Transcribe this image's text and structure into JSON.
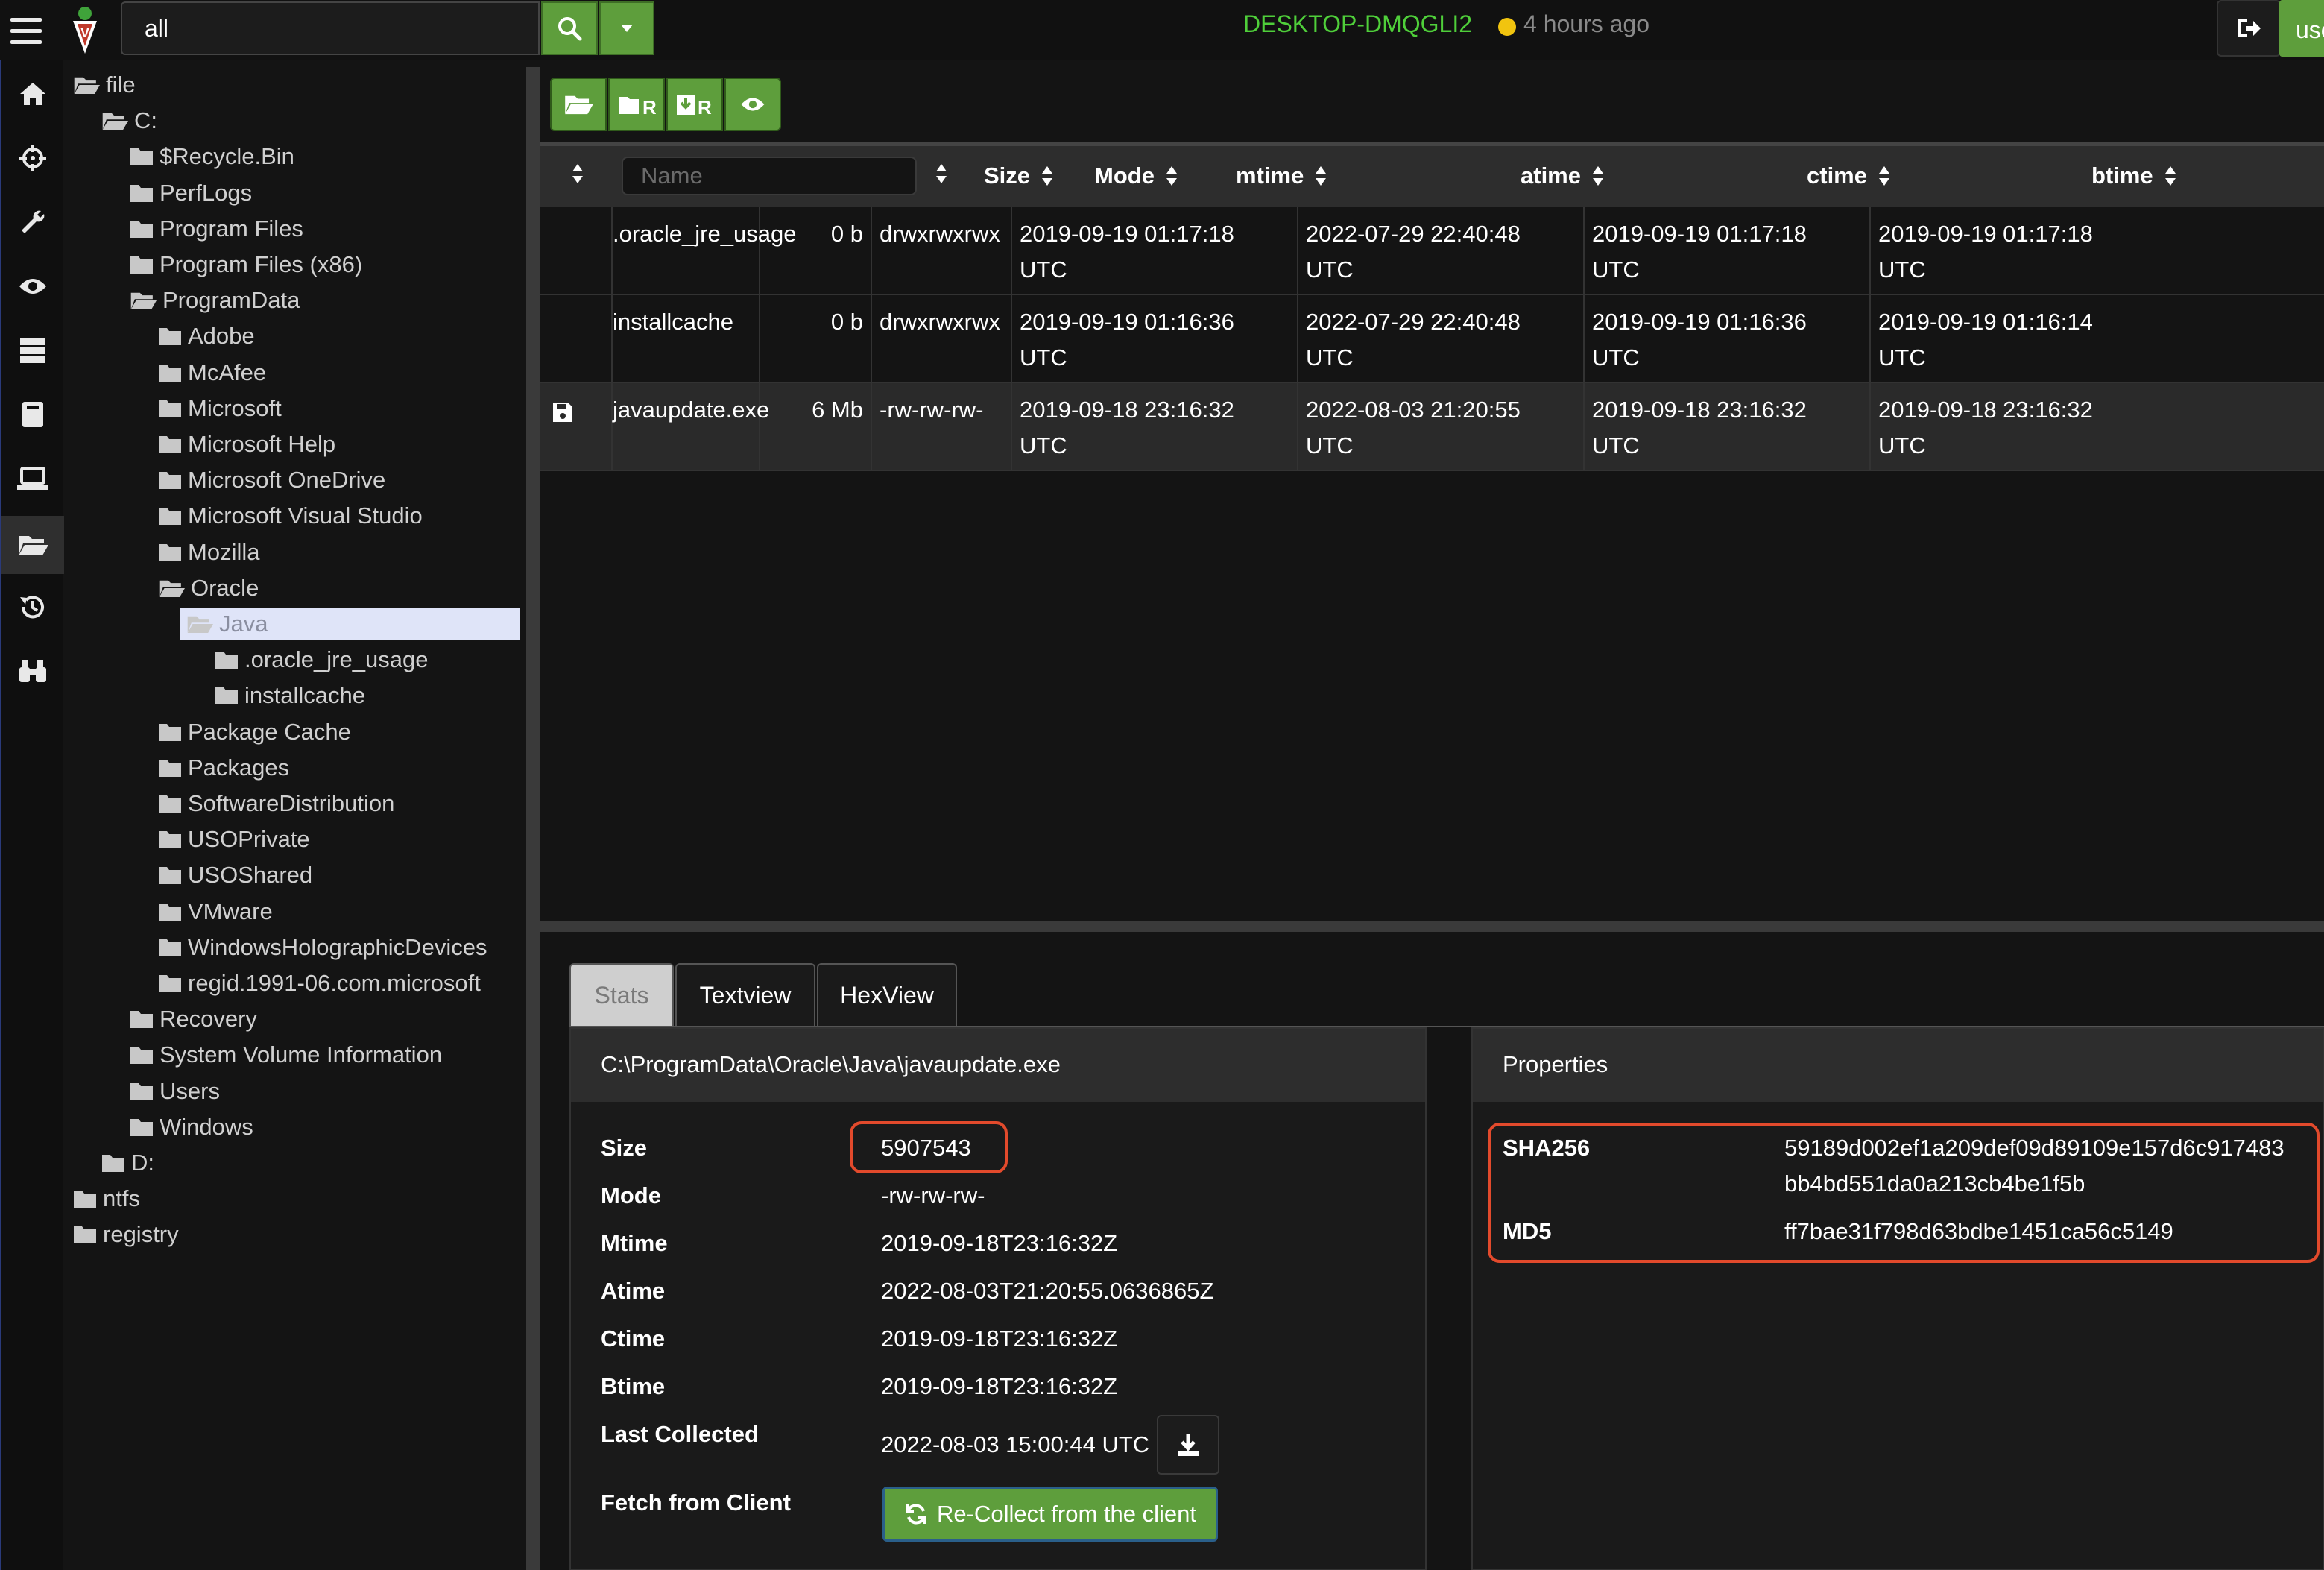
{
  "search": {
    "value": "all"
  },
  "client": {
    "hostname": "DESKTOP-DMQGLI2",
    "last_seen": "4 hours ago",
    "status_color": "#f1c40f"
  },
  "user": {
    "label": "user"
  },
  "sidebar_icons": [
    "home-icon",
    "crosshairs-icon",
    "wrench-icon",
    "eye-icon",
    "server-icon",
    "book-icon",
    "laptop-icon",
    "folder-open-icon",
    "history-icon",
    "binoculars-icon"
  ],
  "tree": [
    {
      "label": "file",
      "depth": 0,
      "open": true
    },
    {
      "label": "C:",
      "depth": 1,
      "open": true
    },
    {
      "label": "$Recycle.Bin",
      "depth": 2
    },
    {
      "label": "PerfLogs",
      "depth": 2
    },
    {
      "label": "Program Files",
      "depth": 2
    },
    {
      "label": "Program Files (x86)",
      "depth": 2
    },
    {
      "label": "ProgramData",
      "depth": 2,
      "open": true
    },
    {
      "label": "Adobe",
      "depth": 3
    },
    {
      "label": "McAfee",
      "depth": 3
    },
    {
      "label": "Microsoft",
      "depth": 3
    },
    {
      "label": "Microsoft Help",
      "depth": 3
    },
    {
      "label": "Microsoft OneDrive",
      "depth": 3
    },
    {
      "label": "Microsoft Visual Studio",
      "depth": 3
    },
    {
      "label": "Mozilla",
      "depth": 3
    },
    {
      "label": "Oracle",
      "depth": 3,
      "open": true
    },
    {
      "label": "Java",
      "depth": 4,
      "open": true,
      "selected": true
    },
    {
      "label": ".oracle_jre_usage",
      "depth": 5
    },
    {
      "label": "installcache",
      "depth": 5
    },
    {
      "label": "Package Cache",
      "depth": 3
    },
    {
      "label": "Packages",
      "depth": 3
    },
    {
      "label": "SoftwareDistribution",
      "depth": 3
    },
    {
      "label": "USOPrivate",
      "depth": 3
    },
    {
      "label": "USOShared",
      "depth": 3
    },
    {
      "label": "VMware",
      "depth": 3
    },
    {
      "label": "WindowsHolographicDevices",
      "depth": 3
    },
    {
      "label": "regid.1991-06.com.microsoft",
      "depth": 3
    },
    {
      "label": "Recovery",
      "depth": 2
    },
    {
      "label": "System Volume Information",
      "depth": 2
    },
    {
      "label": "Users",
      "depth": 2
    },
    {
      "label": "Windows",
      "depth": 2
    },
    {
      "label": "D:",
      "depth": 1
    },
    {
      "label": "ntfs",
      "depth": 0
    },
    {
      "label": "registry",
      "depth": 0
    }
  ],
  "toolbar": [
    "folder-open-icon",
    "refresh-folder-icon",
    "recursive-download-icon",
    "eye-icon"
  ],
  "table": {
    "name_placeholder": "Name",
    "headers": {
      "size": "Size",
      "mode": "Mode",
      "mtime": "mtime",
      "atime": "atime",
      "ctime": "ctime",
      "btime": "btime"
    },
    "rows": [
      {
        "icon": "",
        "name": ".oracle_jre_usage",
        "size": "0 b",
        "mode": "drwxrwxrwx",
        "mtime": [
          "2019-09-19 01:17:18",
          "UTC"
        ],
        "atime": [
          "2022-07-29 22:40:48",
          "UTC"
        ],
        "ctime": [
          "2019-09-19 01:17:18",
          "UTC"
        ],
        "btime": [
          "2019-09-19 01:17:18",
          "UTC"
        ]
      },
      {
        "icon": "",
        "name": "installcache",
        "size": "0 b",
        "mode": "drwxrwxrwx",
        "mtime": [
          "2019-09-19 01:16:36",
          "UTC"
        ],
        "atime": [
          "2022-07-29 22:40:48",
          "UTC"
        ],
        "ctime": [
          "2019-09-19 01:16:36",
          "UTC"
        ],
        "btime": [
          "2019-09-19 01:16:14",
          "UTC"
        ]
      },
      {
        "icon": "save-icon",
        "name": "javaupdate.exe",
        "size": "6 Mb",
        "mode": "-rw-rw-rw-",
        "mtime": [
          "2019-09-18 23:16:32",
          "UTC"
        ],
        "atime": [
          "2022-08-03 21:20:55",
          "UTC"
        ],
        "ctime": [
          "2019-09-18 23:16:32",
          "UTC"
        ],
        "btime": [
          "2019-09-18 23:16:32",
          "UTC"
        ]
      }
    ]
  },
  "tabs": [
    "Stats",
    "Textview",
    "HexView"
  ],
  "stats": {
    "path": "C:\\ProgramData\\Oracle\\Java\\javaupdate.exe",
    "rows": [
      {
        "label": "Size",
        "value": "5907543"
      },
      {
        "label": "Mode",
        "value": "-rw-rw-rw-"
      },
      {
        "label": "Mtime",
        "value": "2019-09-18T23:16:32Z"
      },
      {
        "label": "Atime",
        "value": "2022-08-03T21:20:55.0636865Z"
      },
      {
        "label": "Ctime",
        "value": "2019-09-18T23:16:32Z"
      },
      {
        "label": "Btime",
        "value": "2019-09-18T23:16:32Z"
      },
      {
        "label": "Last Collected",
        "value": "2022-08-03 15:00:44 UTC"
      }
    ],
    "fetch_label": "Fetch from Client",
    "recollect_label": "Re-Collect from the client"
  },
  "properties": {
    "title": "Properties",
    "sha256_label": "SHA256",
    "sha256_line1": "59189d002ef1a209def09d89109e157d6c917483",
    "sha256_line2": "bb4bd551da0a213cb4be1f5b",
    "md5_label": "MD5",
    "md5_value": "ff7bae31f798d63bdbe1451ca56c5149"
  },
  "colors": {
    "accent_green": "#5e9e3c",
    "highlight_red": "#e24a2c",
    "host_green": "#4fcf3a"
  }
}
